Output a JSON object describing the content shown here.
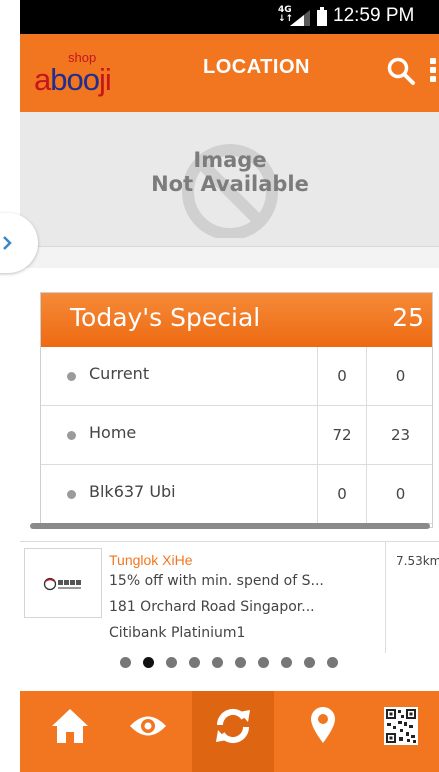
{
  "status_bar": {
    "network": "4G",
    "time": "12:59 PM"
  },
  "app_bar": {
    "logo_shop": "shop",
    "logo_word_a": "a",
    "logo_word_boo": "boo",
    "logo_word_ji": "ji",
    "title": "LOCATION",
    "search_icon": "search-icon",
    "menu_icon": "overflow-menu-icon"
  },
  "banner": {
    "placeholder_line1": "Image",
    "placeholder_line2": "Not Available"
  },
  "special": {
    "title": "Today's Special",
    "count": "25",
    "rows": [
      {
        "label": "Current",
        "c1": "0",
        "c2": "0"
      },
      {
        "label": "Home",
        "c1": "72",
        "c2": "23"
      },
      {
        "label": "Blk637 Ubi",
        "c1": "0",
        "c2": "0"
      }
    ]
  },
  "deal": {
    "name": "Tunglok XiHe",
    "offer": "15% off with min. spend of S...",
    "address": "181 Orchard Road Singapor...",
    "card": "Citibank Platinium1",
    "distance": "7.53km"
  },
  "pager": {
    "total": 10,
    "active": 1
  },
  "bottom_nav": {
    "items": [
      "home-icon",
      "eye-icon",
      "refresh-icon",
      "location-pin-icon",
      "qr-code-icon"
    ],
    "active": 2
  },
  "colors": {
    "brand_orange": "#f2761f",
    "logo_red": "#c4161c",
    "logo_blue": "#1f2e8f"
  }
}
